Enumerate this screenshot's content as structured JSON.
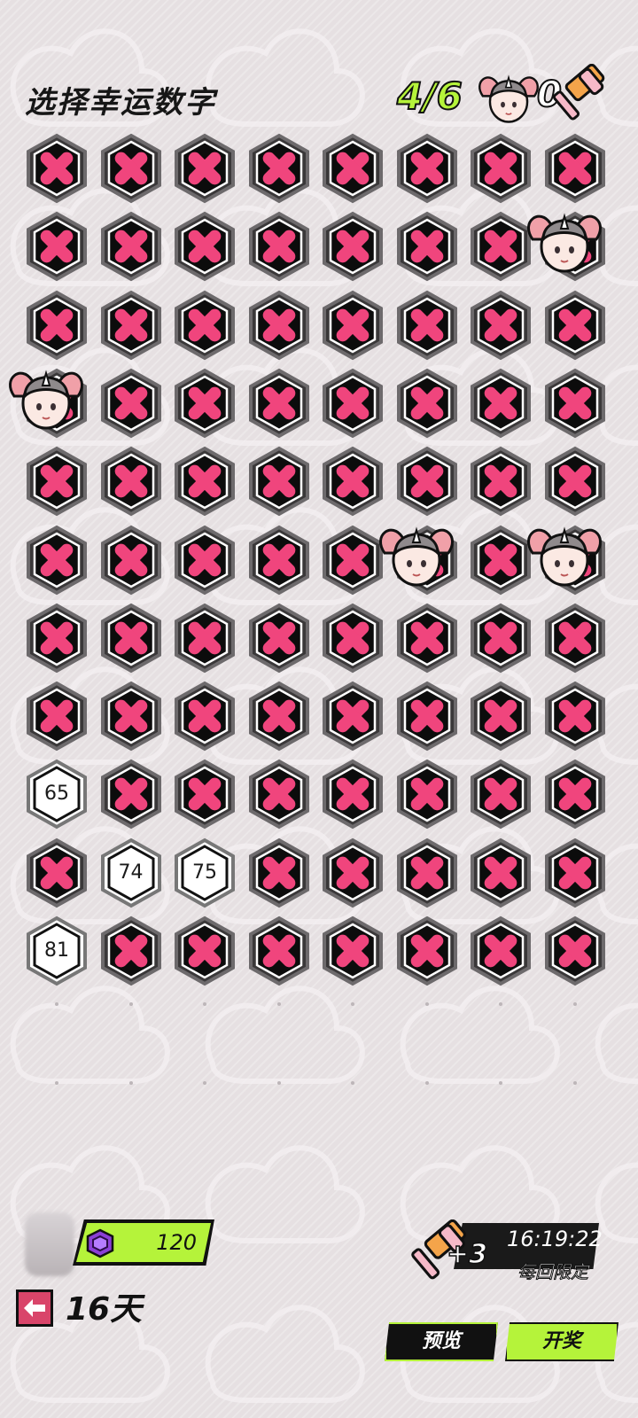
{
  "header": {
    "title": "选择幸运数字",
    "counter": "4/6",
    "hammer_count": "0"
  },
  "grid": {
    "columns": 8,
    "rows": 11,
    "revealed": [
      {
        "row": 8,
        "col": 0,
        "number": "65"
      },
      {
        "row": 9,
        "col": 1,
        "number": "74"
      },
      {
        "row": 9,
        "col": 2,
        "number": "75"
      },
      {
        "row": 10,
        "col": 0,
        "number": "81"
      }
    ],
    "elephants": [
      {
        "row": 1,
        "col": 7
      },
      {
        "row": 3,
        "col": 0
      },
      {
        "row": 5,
        "col": 5
      },
      {
        "row": 5,
        "col": 7
      }
    ],
    "colors": {
      "cross": "#f0457d",
      "tile_dark": "#0c0c0c",
      "tile_frame": "#6d6a6c",
      "accent_green": "#b5f33a"
    }
  },
  "footer": {
    "currency_value": "120",
    "currency_icon": "purple-cube-icon",
    "days_label": "16天",
    "reward": {
      "plus": "+3",
      "timer": "16:19:22",
      "limit": "每回限定"
    },
    "buttons": {
      "preview": "预览",
      "draw": "开奖"
    }
  }
}
